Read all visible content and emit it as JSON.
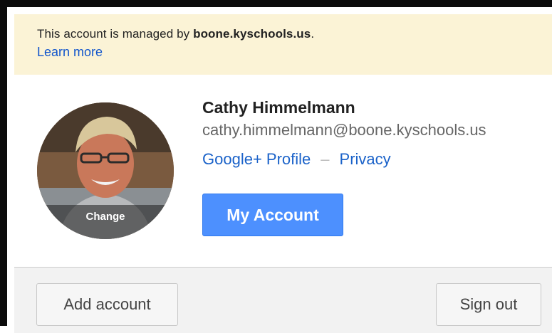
{
  "notice": {
    "prefix": "This account is managed by ",
    "domain": "boone.kyschools.us",
    "suffix": ".",
    "learn_more": "Learn more"
  },
  "avatar": {
    "change_label": "Change"
  },
  "user": {
    "name": "Cathy Himmelmann",
    "email": "cathy.himmelmann@boone.kyschools.us"
  },
  "links": {
    "profile": "Google+ Profile",
    "separator": "–",
    "privacy": "Privacy"
  },
  "buttons": {
    "my_account": "My Account",
    "add_account": "Add account",
    "sign_out": "Sign out"
  },
  "colors": {
    "notice_bg": "#fbf3d6",
    "link": "#1a62c9",
    "primary": "#4d90fe",
    "footer_bg": "#f2f2f2"
  }
}
